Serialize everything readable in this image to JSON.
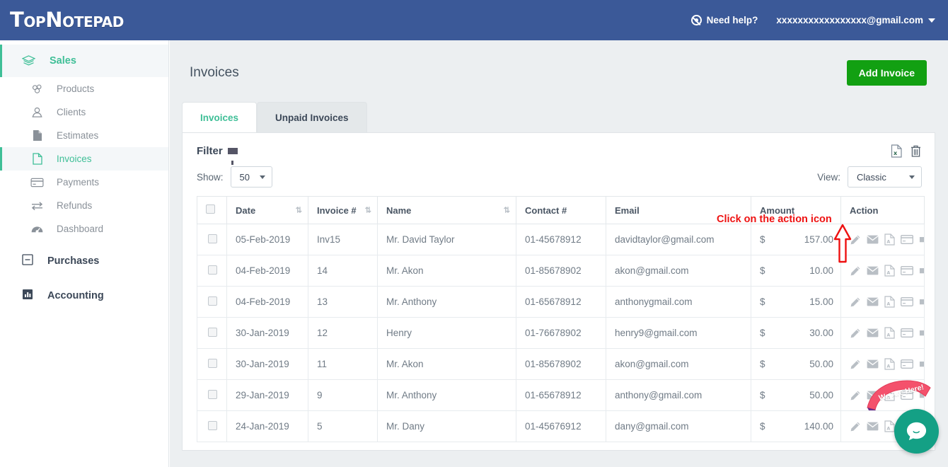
{
  "app": {
    "logo": "TopNotepad",
    "brand_color": "#3b5998",
    "accent_color": "#3fbf97",
    "add_button_color": "#12a012"
  },
  "header": {
    "help_label": "Need help?",
    "help_icon": "life-ring-icon",
    "user_email": "xxxxxxxxxxxxxxxxx@gmail.com",
    "user_caret_icon": "caret-down-icon"
  },
  "sidebar": {
    "groups": [
      {
        "label": "Sales",
        "icon": "layers-icon",
        "active": true,
        "items": [
          {
            "label": "Products",
            "icon": "cubes-icon",
            "active": false
          },
          {
            "label": "Clients",
            "icon": "user-icon",
            "active": false
          },
          {
            "label": "Estimates",
            "icon": "file-icon",
            "active": false
          },
          {
            "label": "Invoices",
            "icon": "file-invoice-icon",
            "active": true
          },
          {
            "label": "Payments",
            "icon": "credit-card-icon",
            "active": false
          },
          {
            "label": "Refunds",
            "icon": "exchange-arrows-icon",
            "active": false
          },
          {
            "label": "Dashboard",
            "icon": "tachometer-icon",
            "active": false
          }
        ]
      }
    ],
    "top_level": [
      {
        "label": "Purchases",
        "icon": "minus-square-icon"
      },
      {
        "label": "Accounting",
        "icon": "bar-chart-icon"
      }
    ]
  },
  "main": {
    "page_title": "Invoices",
    "add_button": "Add Invoice",
    "tabs": [
      {
        "label": "Invoices",
        "active": true
      },
      {
        "label": "Unpaid Invoices",
        "active": false
      }
    ],
    "filter_label": "Filter",
    "filter_icon": "funnel-icon",
    "panel_icons": [
      {
        "name": "export-excel-icon"
      },
      {
        "name": "delete-trash-icon"
      }
    ],
    "show_label": "Show:",
    "show_value": "50",
    "view_label": "View:",
    "view_value": "Classic"
  },
  "table": {
    "columns": [
      {
        "key": "check",
        "label": "",
        "sortable": false
      },
      {
        "key": "date",
        "label": "Date",
        "sortable": true
      },
      {
        "key": "invoice",
        "label": "Invoice #",
        "sortable": true
      },
      {
        "key": "name",
        "label": "Name",
        "sortable": true
      },
      {
        "key": "contact",
        "label": "Contact #",
        "sortable": false
      },
      {
        "key": "email",
        "label": "Email",
        "sortable": false
      },
      {
        "key": "amount",
        "label": "Amount",
        "sortable": false
      },
      {
        "key": "action",
        "label": "Action",
        "sortable": false
      }
    ],
    "currency_symbol": "$",
    "action_icons": [
      "pencil-icon",
      "envelope-icon",
      "pdf-file-icon",
      "credit-card-icon",
      "ellipsis-icon"
    ],
    "rows": [
      {
        "date": "05-Feb-2019",
        "invoice": "Inv15",
        "name": "Mr. David Taylor",
        "contact": "01-45678912",
        "email": "davidtaylor@gmail.com",
        "amount": "157.00"
      },
      {
        "date": "04-Feb-2019",
        "invoice": "14",
        "name": "Mr. Akon",
        "contact": "01-85678902",
        "email": "akon@gmail.com",
        "amount": "10.00"
      },
      {
        "date": "04-Feb-2019",
        "invoice": "13",
        "name": "Mr. Anthony",
        "contact": "01-65678912",
        "email": "anthonygmail.com",
        "amount": "15.00"
      },
      {
        "date": "30-Jan-2019",
        "invoice": "12",
        "name": "Henry",
        "contact": "01-76678902",
        "email": "henry9@gmail.com",
        "amount": "30.00"
      },
      {
        "date": "30-Jan-2019",
        "invoice": "11",
        "name": "Mr. Akon",
        "contact": "01-85678902",
        "email": "akon@gmail.com",
        "amount": "50.00"
      },
      {
        "date": "29-Jan-2019",
        "invoice": "9",
        "name": "Mr. Anthony",
        "contact": "01-65678912",
        "email": "anthony@gmail.com",
        "amount": "50.00"
      },
      {
        "date": "24-Jan-2019",
        "invoice": "5",
        "name": "Mr. Dany",
        "contact": "01-45676912",
        "email": "dany@gmail.com",
        "amount": "140.00"
      }
    ]
  },
  "annotation": {
    "text": "Click on the action icon",
    "color": "#ee1111",
    "arrow_icon": "up-arrow-annotation-icon",
    "highlight_target": "envelope-icon"
  },
  "chat_widget": {
    "ribbon_text": "We Are Here!",
    "ribbon_color": "#f4516c",
    "button_color": "#14a085",
    "button_icon": "chat-bubble-icon"
  }
}
